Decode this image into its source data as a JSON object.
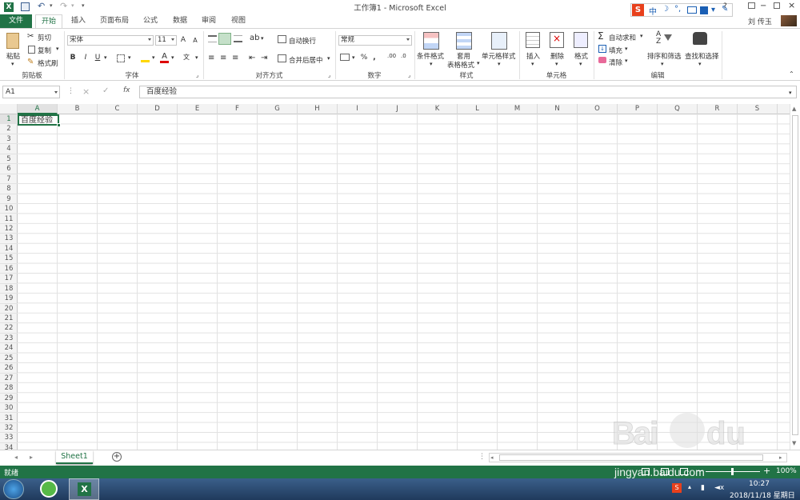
{
  "window": {
    "title": "工作簿1 - Microsoft Excel",
    "user": "刘 传玉"
  },
  "tabs": [
    {
      "label": "文件"
    },
    {
      "label": "开始"
    },
    {
      "label": "插入"
    },
    {
      "label": "页面布局"
    },
    {
      "label": "公式"
    },
    {
      "label": "数据"
    },
    {
      "label": "审阅"
    },
    {
      "label": "视图"
    }
  ],
  "ribbon": {
    "clipboard": {
      "paste": "粘贴",
      "cut": "剪切",
      "copy": "复制",
      "format_painter": "格式刷",
      "group": "剪贴板"
    },
    "font": {
      "name": "宋体",
      "size": "11",
      "bold": "B",
      "italic": "I",
      "underline": "U",
      "group": "字体"
    },
    "alignment": {
      "wrap": "自动换行",
      "merge": "合并后居中",
      "group": "对齐方式"
    },
    "number": {
      "format": "常规",
      "percent": "%",
      "comma": ",",
      "group": "数字"
    },
    "styles": {
      "conditional": "条件格式",
      "table_l1": "套用",
      "table_l2": "表格格式",
      "cell_styles": "单元格样式",
      "group": "样式"
    },
    "cells": {
      "insert": "插入",
      "delete": "删除",
      "format": "格式",
      "group": "单元格"
    },
    "editing": {
      "autosum": "自动求和",
      "fill": "填充",
      "clear": "清除",
      "sort": "排序和筛选",
      "find": "查找和选择",
      "group": "编辑"
    }
  },
  "formula_bar": {
    "name_box": "A1",
    "fx": "fx",
    "content": "百度经验"
  },
  "columns": [
    "A",
    "B",
    "C",
    "D",
    "E",
    "F",
    "G",
    "H",
    "I",
    "J",
    "K",
    "L",
    "M",
    "N",
    "O",
    "P",
    "Q",
    "R",
    "S"
  ],
  "rows": [
    "1",
    "2",
    "3",
    "4",
    "5",
    "6",
    "7",
    "8",
    "9",
    "10",
    "11",
    "12",
    "13",
    "14",
    "15",
    "16",
    "17",
    "18",
    "19",
    "20",
    "21",
    "22",
    "23",
    "24",
    "25",
    "26",
    "27",
    "28",
    "29",
    "30",
    "31",
    "32",
    "33",
    "34"
  ],
  "cells": {
    "A1": "百度经验"
  },
  "sheet_tabs": [
    {
      "label": "Sheet1"
    }
  ],
  "status": {
    "ready": "就绪",
    "zoom": "100%"
  },
  "ime": {
    "label": "中"
  },
  "watermark": {
    "site": "jingyan.baidu.com"
  },
  "taskbar": {
    "time": "10:27",
    "date": "2018/11/18 星期日"
  },
  "colors": {
    "excel_green": "#217346"
  }
}
